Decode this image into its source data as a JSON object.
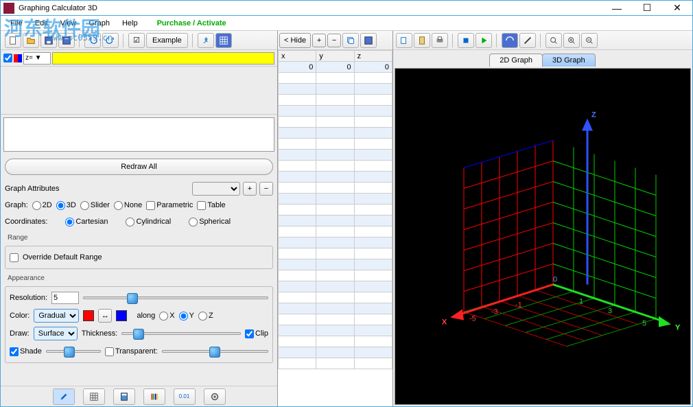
{
  "window": {
    "title": "Graphing Calculator 3D"
  },
  "menu": {
    "file": "File",
    "edit": "Edit",
    "view": "View",
    "graph": "Graph",
    "help": "Help",
    "activate": "Purchase / Activate"
  },
  "toolbar": {
    "example": "Example"
  },
  "equation": {
    "drop": "z= ▼",
    "value": ""
  },
  "redraw": "Redraw All",
  "attrs": {
    "title": "Graph Attributes",
    "graph_label": "Graph:",
    "types": {
      "2d": "2D",
      "3d": "3D",
      "slider": "Slider",
      "none": "None"
    },
    "parametric": "Parametric",
    "table": "Table",
    "coords_label": "Coordinates:",
    "coords": {
      "cartesian": "Cartesian",
      "cylindrical": "Cylindrical",
      "spherical": "Spherical"
    },
    "range_title": "Range",
    "override": "Override Default Range",
    "appearance_title": "Appearance",
    "resolution_label": "Resolution:",
    "resolution_value": "5",
    "color_label": "Color:",
    "color_mode": "Gradual",
    "along": "along",
    "axis": {
      "x": "X",
      "y": "Y",
      "z": "Z"
    },
    "draw_label": "Draw:",
    "draw_mode": "Surface",
    "thickness": "Thickness:",
    "clip": "Clip",
    "shade": "Shade",
    "transparent": "Transparent:"
  },
  "midpane": {
    "hide": "< Hide",
    "cols": {
      "x": "x",
      "y": "y",
      "z": "z"
    },
    "row0": {
      "x": "0",
      "y": "0",
      "z": "0"
    }
  },
  "tabs": {
    "2d": "2D Graph",
    "3d": "3D Graph"
  },
  "axes3d": {
    "x": "X",
    "y": "Y",
    "z": "Z"
  },
  "watermark": {
    "text": "河东软件园",
    "url": "www.pc0359.cn"
  }
}
